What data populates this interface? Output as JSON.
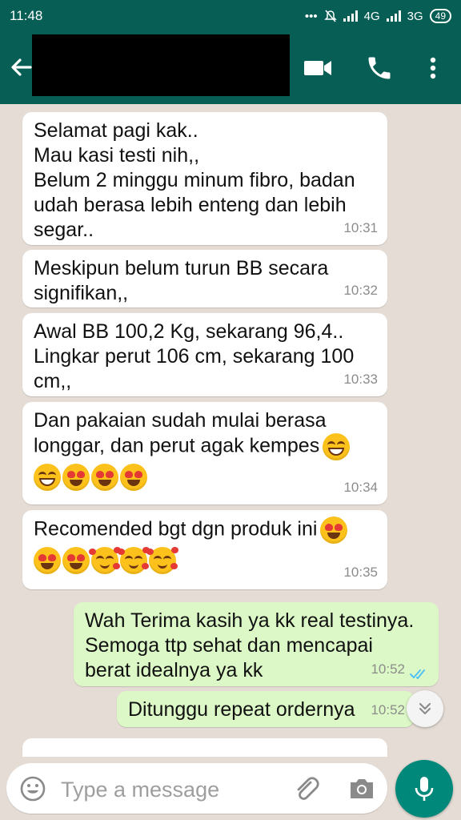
{
  "status_bar": {
    "time": "11:48",
    "network_1": "4G",
    "network_2": "3G",
    "battery": "49"
  },
  "header": {
    "icons": [
      "back-arrow-icon",
      "video-call-icon",
      "phone-icon",
      "more-vert-icon"
    ]
  },
  "messages": [
    {
      "direction": "in",
      "text": "Selamat pagi kak..\nMau kasi testi nih,,\nBelum 2 minggu minum fibro, badan udah berasa lebih enteng dan lebih segar..",
      "time": "10:31"
    },
    {
      "direction": "in",
      "text": "Meskipun belum turun BB secara signifikan,,",
      "time": "10:32"
    },
    {
      "direction": "in",
      "text": "Awal BB 100,2 Kg,  sekarang 96,4..\nLingkar perut 106 cm,  sekarang 100 cm,,",
      "time": "10:33"
    },
    {
      "direction": "in",
      "text": "Dan pakaian sudah mulai berasa longgar, dan perut agak kempes",
      "emojis": [
        "grinning-face",
        "grinning-face",
        "heart-eyes-face",
        "heart-eyes-face",
        "heart-eyes-face"
      ],
      "time": "10:34"
    },
    {
      "direction": "in",
      "text": "Recomended bgt dgn produk ini",
      "emojis": [
        "heart-eyes-face",
        "heart-eyes-face",
        "heart-eyes-face",
        "smiling-face-with-hearts",
        "smiling-face-with-hearts",
        "smiling-face-with-hearts"
      ],
      "time": "10:35"
    },
    {
      "direction": "out",
      "text": "Wah Terima kasih ya kk real testinya.\nSemoga ttp sehat dan mencapai berat idealnya ya kk",
      "time": "10:52",
      "status": "read"
    },
    {
      "direction": "out",
      "text": "Ditunggu repeat ordernya",
      "time": "10:52"
    }
  ],
  "composer": {
    "placeholder": "Type a message"
  },
  "colors": {
    "header": "#075e54",
    "incoming_bubble": "#ffffff",
    "outgoing_bubble": "#dcf8c6",
    "mic_button": "#00897b",
    "read_ticks": "#4fc3f7"
  }
}
